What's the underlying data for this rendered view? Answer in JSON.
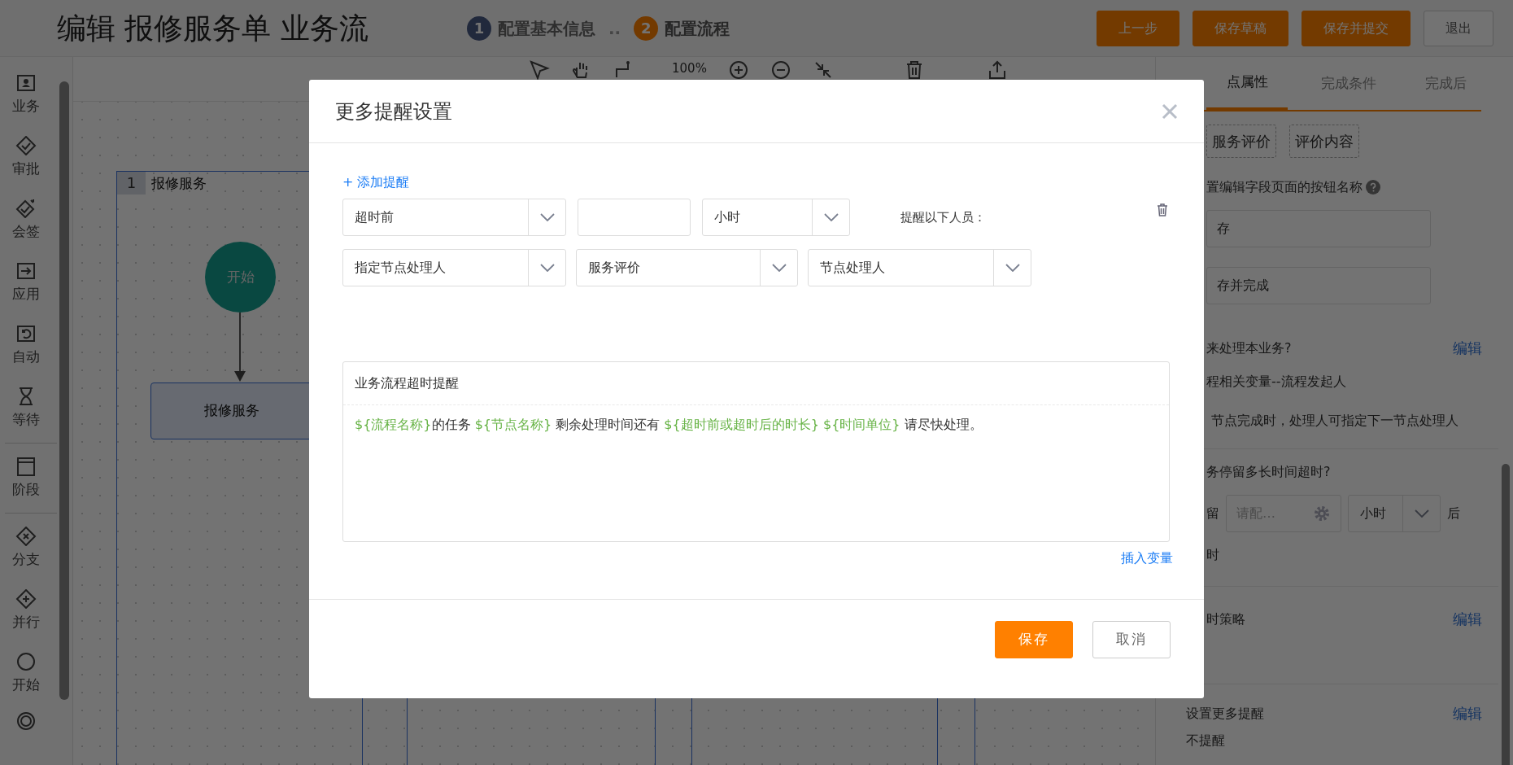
{
  "header": {
    "title": "编辑 报修服务单 业务流",
    "steps": [
      {
        "number": "1",
        "label": "配置基本信息",
        "selected": false
      },
      {
        "number": "2",
        "label": "配置流程",
        "selected": true
      }
    ],
    "step_separator": "..",
    "buttons": [
      {
        "label": "上一步",
        "kind": "primary"
      },
      {
        "label": "保存草稿",
        "kind": "primary"
      },
      {
        "label": "保存并提交",
        "kind": "primary"
      },
      {
        "label": "退出",
        "kind": "outline"
      }
    ]
  },
  "toolbar": {
    "zoom": "100%"
  },
  "palette_groups": [
    {
      "items": [
        {
          "label": "业务",
          "kind": "card"
        },
        {
          "label": "审批",
          "kind": "approve"
        },
        {
          "label": "会签",
          "kind": "cosign"
        },
        {
          "label": "应用",
          "kind": "app"
        },
        {
          "label": "自动",
          "kind": "auto"
        },
        {
          "label": "等待",
          "kind": "wait"
        }
      ]
    },
    {
      "items": [
        {
          "label": "阶段",
          "kind": "stage"
        }
      ]
    },
    {
      "items": [
        {
          "label": "分支",
          "kind": "branch"
        },
        {
          "label": "并行",
          "kind": "parallel"
        },
        {
          "label": "开始",
          "kind": "start"
        },
        {
          "kind": "end"
        }
      ]
    }
  ],
  "canvas": {
    "lane": {
      "number": "1",
      "title": "报修服务"
    },
    "start_node": "开始",
    "task_node": "报修服务"
  },
  "properties_panel": {
    "tabs": [
      {
        "label": "点属性",
        "selected": true
      },
      {
        "label": "完成条件",
        "selected": false
      },
      {
        "label": "完成后",
        "selected": false
      }
    ],
    "field_chips": [
      "服务评价",
      "评价内容"
    ],
    "button_name_label": "置编辑字段页面的按钮名称",
    "button_names": [
      "存",
      "存并完成"
    ],
    "handler": {
      "title": "来处理本业务?",
      "edit": "编辑",
      "value": "程相关变量--流程发起人",
      "note": "节点完成时，处理人可指定下一节点处理人"
    },
    "timeout": {
      "title": "务停留多长时间超时?",
      "prefix": "留",
      "placeholder": "请配…",
      "unit": "小时",
      "suffix": "后",
      "tail": "时"
    },
    "strategy": {
      "title": "时策略",
      "edit": "编辑"
    },
    "reminders": {
      "title": "设置更多提醒",
      "edit": "编辑",
      "value": "不提醒"
    }
  },
  "dialog": {
    "title": "更多提醒设置",
    "add_link": "+ 添加提醒",
    "rules": [
      {
        "timing": "超时前",
        "unit": "小时",
        "recipients_label": "提醒以下人员：",
        "recipient_type": "指定节点处理人",
        "recipient_source": "服务评价",
        "recipient": "节点处理人"
      }
    ],
    "template": {
      "subject": "业务流程超时提醒",
      "body": [
        {
          "kind": "variable",
          "text": "${流程名称}"
        },
        {
          "kind": "text",
          "text": "的任务 "
        },
        {
          "kind": "variable",
          "text": "${节点名称}"
        },
        {
          "kind": "text",
          "text": " 剩余处理时间还有 "
        },
        {
          "kind": "variable",
          "text": "${超时前或超时后的时长} ${时间单位}"
        },
        {
          "kind": "text",
          "text": " 请尽快处理。"
        }
      ]
    },
    "insert_link": "插入变量",
    "buttons": [
      {
        "label": "保存",
        "kind": "primary"
      },
      {
        "label": "取消",
        "kind": "outline"
      }
    ]
  }
}
